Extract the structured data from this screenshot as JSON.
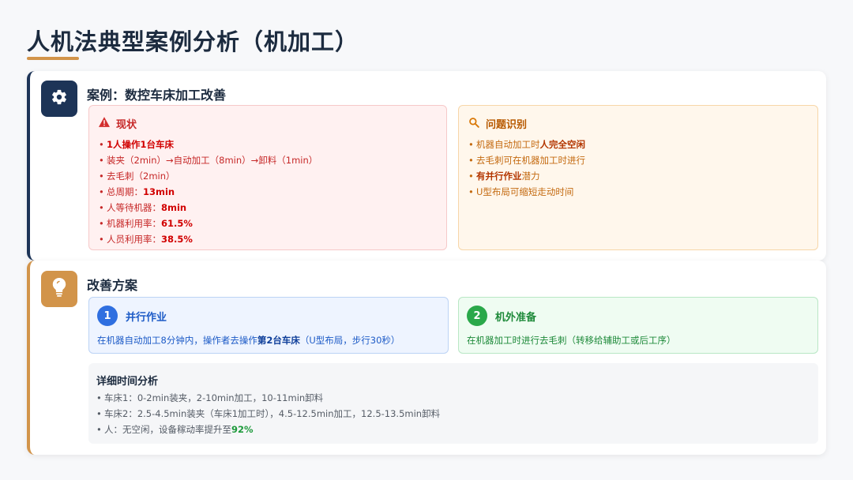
{
  "page": {
    "title": "人机法典型案例分析（机加工）"
  },
  "case": {
    "heading": "案例：数控车床加工改善",
    "icon": "gear-icon",
    "status": {
      "title": "现状",
      "icon": "warning-icon",
      "items": [
        {
          "text": "",
          "strong": "1人操作1台车床"
        },
        {
          "text": "装夹（2min）→自动加工（8min）→卸料（1min）",
          "strong": ""
        },
        {
          "text": "去毛刺（2min）",
          "strong": ""
        },
        {
          "text": "总周期：",
          "strong": "13min"
        },
        {
          "text": "人等待机器：",
          "strong": "8min"
        },
        {
          "text": "机器利用率：",
          "strong": "61.5%"
        },
        {
          "text": "人员利用率：",
          "strong": "38.5%"
        }
      ]
    },
    "issues": {
      "title": "问题识别",
      "icon": "search-icon",
      "items": [
        {
          "text": "机器自动加工时",
          "strong": "人完全空闲",
          "tail": ""
        },
        {
          "text": "去毛刺可在机器加工时进行",
          "strong": "",
          "tail": ""
        },
        {
          "text": "",
          "strong": "有并行作业",
          "tail": "潜力"
        },
        {
          "text": "U型布局可缩短走动时间",
          "strong": "",
          "tail": ""
        }
      ]
    }
  },
  "plan": {
    "heading": "改善方案",
    "icon": "lightbulb-icon",
    "solution1": {
      "number": "1",
      "title": "并行作业",
      "text": "在机器自动加工8分钟内，操作者去操作",
      "strong": "第2台车床",
      "tail": "（U型布局，步行30秒）"
    },
    "solution2": {
      "number": "2",
      "title": "机外准备",
      "text": "在机器加工时进行去毛刺（转移给辅助工或后工序）"
    },
    "analysis": {
      "title": "详细时间分析",
      "items": [
        {
          "text": "车床1：0-2min装夹，2-10min加工，10-11min卸料",
          "strong": ""
        },
        {
          "text": "车床2：2.5-4.5min装夹（车床1加工时），4.5-12.5min加工，12.5-13.5min卸料",
          "strong": ""
        },
        {
          "text": "人：无空闲，设备稼动率提升至",
          "strong": "92%"
        }
      ]
    }
  },
  "colors": {
    "navy": "#1d3457",
    "accent": "#d2944a",
    "danger": "#c62828",
    "warning": "#c46a10",
    "blue": "#1d5bc7",
    "green": "#1e8a3a"
  }
}
